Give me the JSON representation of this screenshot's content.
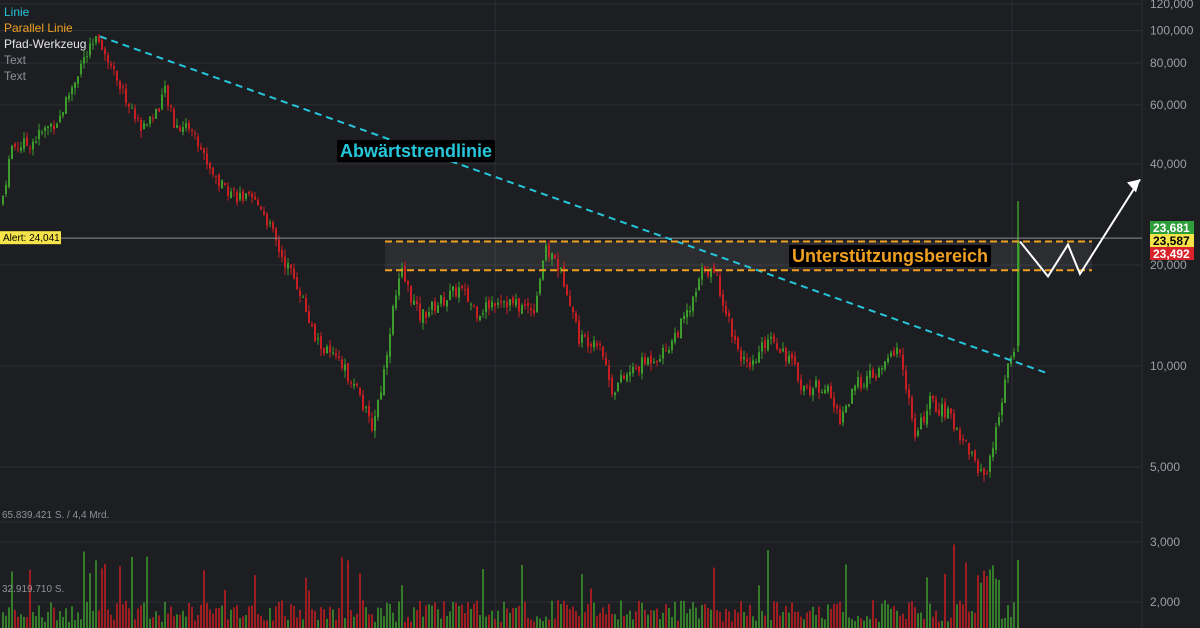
{
  "chart_data": {
    "type": "candlestick",
    "scale": "log",
    "grid": true,
    "colors": {
      "background": "#1c1e22",
      "grid": "#2c2f35",
      "up": "#3c9c2c",
      "down": "#c81e22",
      "trendline": "#26c6da",
      "parallel": "#f0a020",
      "path": "#ffffff",
      "alert_line": "#8a8d92"
    },
    "legend": [
      {
        "name": "Linie",
        "color": "#26c6da"
      },
      {
        "name": "Parallel Linie",
        "color": "#f0a020"
      },
      {
        "name": "Pfad-Werkzeug",
        "color": "#e6e6e6"
      },
      {
        "name": "Text",
        "color": "#8e9399"
      },
      {
        "name": "Text",
        "color": "#8e9399"
      }
    ],
    "y_ticks": [
      {
        "value": 120000,
        "label": "120,000"
      },
      {
        "value": 100000,
        "label": "100,000"
      },
      {
        "value": 80000,
        "label": "80,000"
      },
      {
        "value": 60000,
        "label": "60,000"
      },
      {
        "value": 40000,
        "label": "40,000"
      },
      {
        "value": 20000,
        "label": "20,000"
      },
      {
        "value": 10000,
        "label": "10,000"
      },
      {
        "value": 5000,
        "label": "5,000"
      },
      {
        "value": 3000,
        "label": "3,000"
      },
      {
        "value": 2000,
        "label": "2,000"
      }
    ],
    "price_path": [
      [
        0,
        28000
      ],
      [
        12,
        45000
      ],
      [
        30,
        46000
      ],
      [
        60,
        55000
      ],
      [
        82,
        80000
      ],
      [
        100,
        96000
      ],
      [
        112,
        78000
      ],
      [
        125,
        64000
      ],
      [
        140,
        52000
      ],
      [
        155,
        56000
      ],
      [
        165,
        66000
      ],
      [
        175,
        52000
      ],
      [
        190,
        52000
      ],
      [
        205,
        42000
      ],
      [
        220,
        35000
      ],
      [
        240,
        32000
      ],
      [
        262,
        30000
      ],
      [
        280,
        22000
      ],
      [
        300,
        17000
      ],
      [
        315,
        12000
      ],
      [
        335,
        10500
      ],
      [
        355,
        9000
      ],
      [
        372,
        6500
      ],
      [
        383,
        9000
      ],
      [
        392,
        14000
      ],
      [
        402,
        19000
      ],
      [
        420,
        14000
      ],
      [
        440,
        15500
      ],
      [
        460,
        17000
      ],
      [
        478,
        14500
      ],
      [
        500,
        16000
      ],
      [
        520,
        15000
      ],
      [
        535,
        15000
      ],
      [
        545,
        22000
      ],
      [
        555,
        21000
      ],
      [
        568,
        17000
      ],
      [
        580,
        12000
      ],
      [
        600,
        12000
      ],
      [
        612,
        8500
      ],
      [
        630,
        9500
      ],
      [
        650,
        10500
      ],
      [
        665,
        11000
      ],
      [
        680,
        13000
      ],
      [
        692,
        15000
      ],
      [
        705,
        20000
      ],
      [
        718,
        18000
      ],
      [
        735,
        12000
      ],
      [
        750,
        9500
      ],
      [
        770,
        12500
      ],
      [
        790,
        10500
      ],
      [
        805,
        8500
      ],
      [
        825,
        8800
      ],
      [
        840,
        7000
      ],
      [
        860,
        9000
      ],
      [
        880,
        9500
      ],
      [
        898,
        11500
      ],
      [
        908,
        8500
      ],
      [
        915,
        6000
      ],
      [
        930,
        7800
      ],
      [
        948,
        7200
      ],
      [
        965,
        6000
      ],
      [
        978,
        5000
      ],
      [
        985,
        4700
      ],
      [
        995,
        6000
      ],
      [
        1005,
        9000
      ],
      [
        1012,
        10500
      ],
      [
        1016,
        12000
      ],
      [
        1018,
        23600
      ]
    ],
    "peak": 96000,
    "volume_axis_labels": {
      "top": "65.839.421 S. / 4,4 Mrd.",
      "mid": "32.919.710 S."
    },
    "annotations": {
      "trendline_label": "Abwärtstrendlinie",
      "support_label": "Unterstützungsbereich",
      "alert_label": "Alert: 24,041",
      "alert_value": 24041,
      "price_tags": [
        {
          "label": "23,681",
          "value": 23681,
          "color": "#2e9e3a",
          "text_color": "#ffffff"
        },
        {
          "label": "23,587",
          "value": 23587,
          "color": "#f5e34a",
          "text_color": "#000000"
        },
        {
          "label": "23,492",
          "value": 23492,
          "color": "#d8232a",
          "text_color": "#ffffff"
        }
      ],
      "support_upper": 23500,
      "support_lower": 19300,
      "trend_start": 96000,
      "trend_end": 9500,
      "projection": [
        23500,
        18500,
        23000,
        18800,
        36000
      ]
    }
  }
}
